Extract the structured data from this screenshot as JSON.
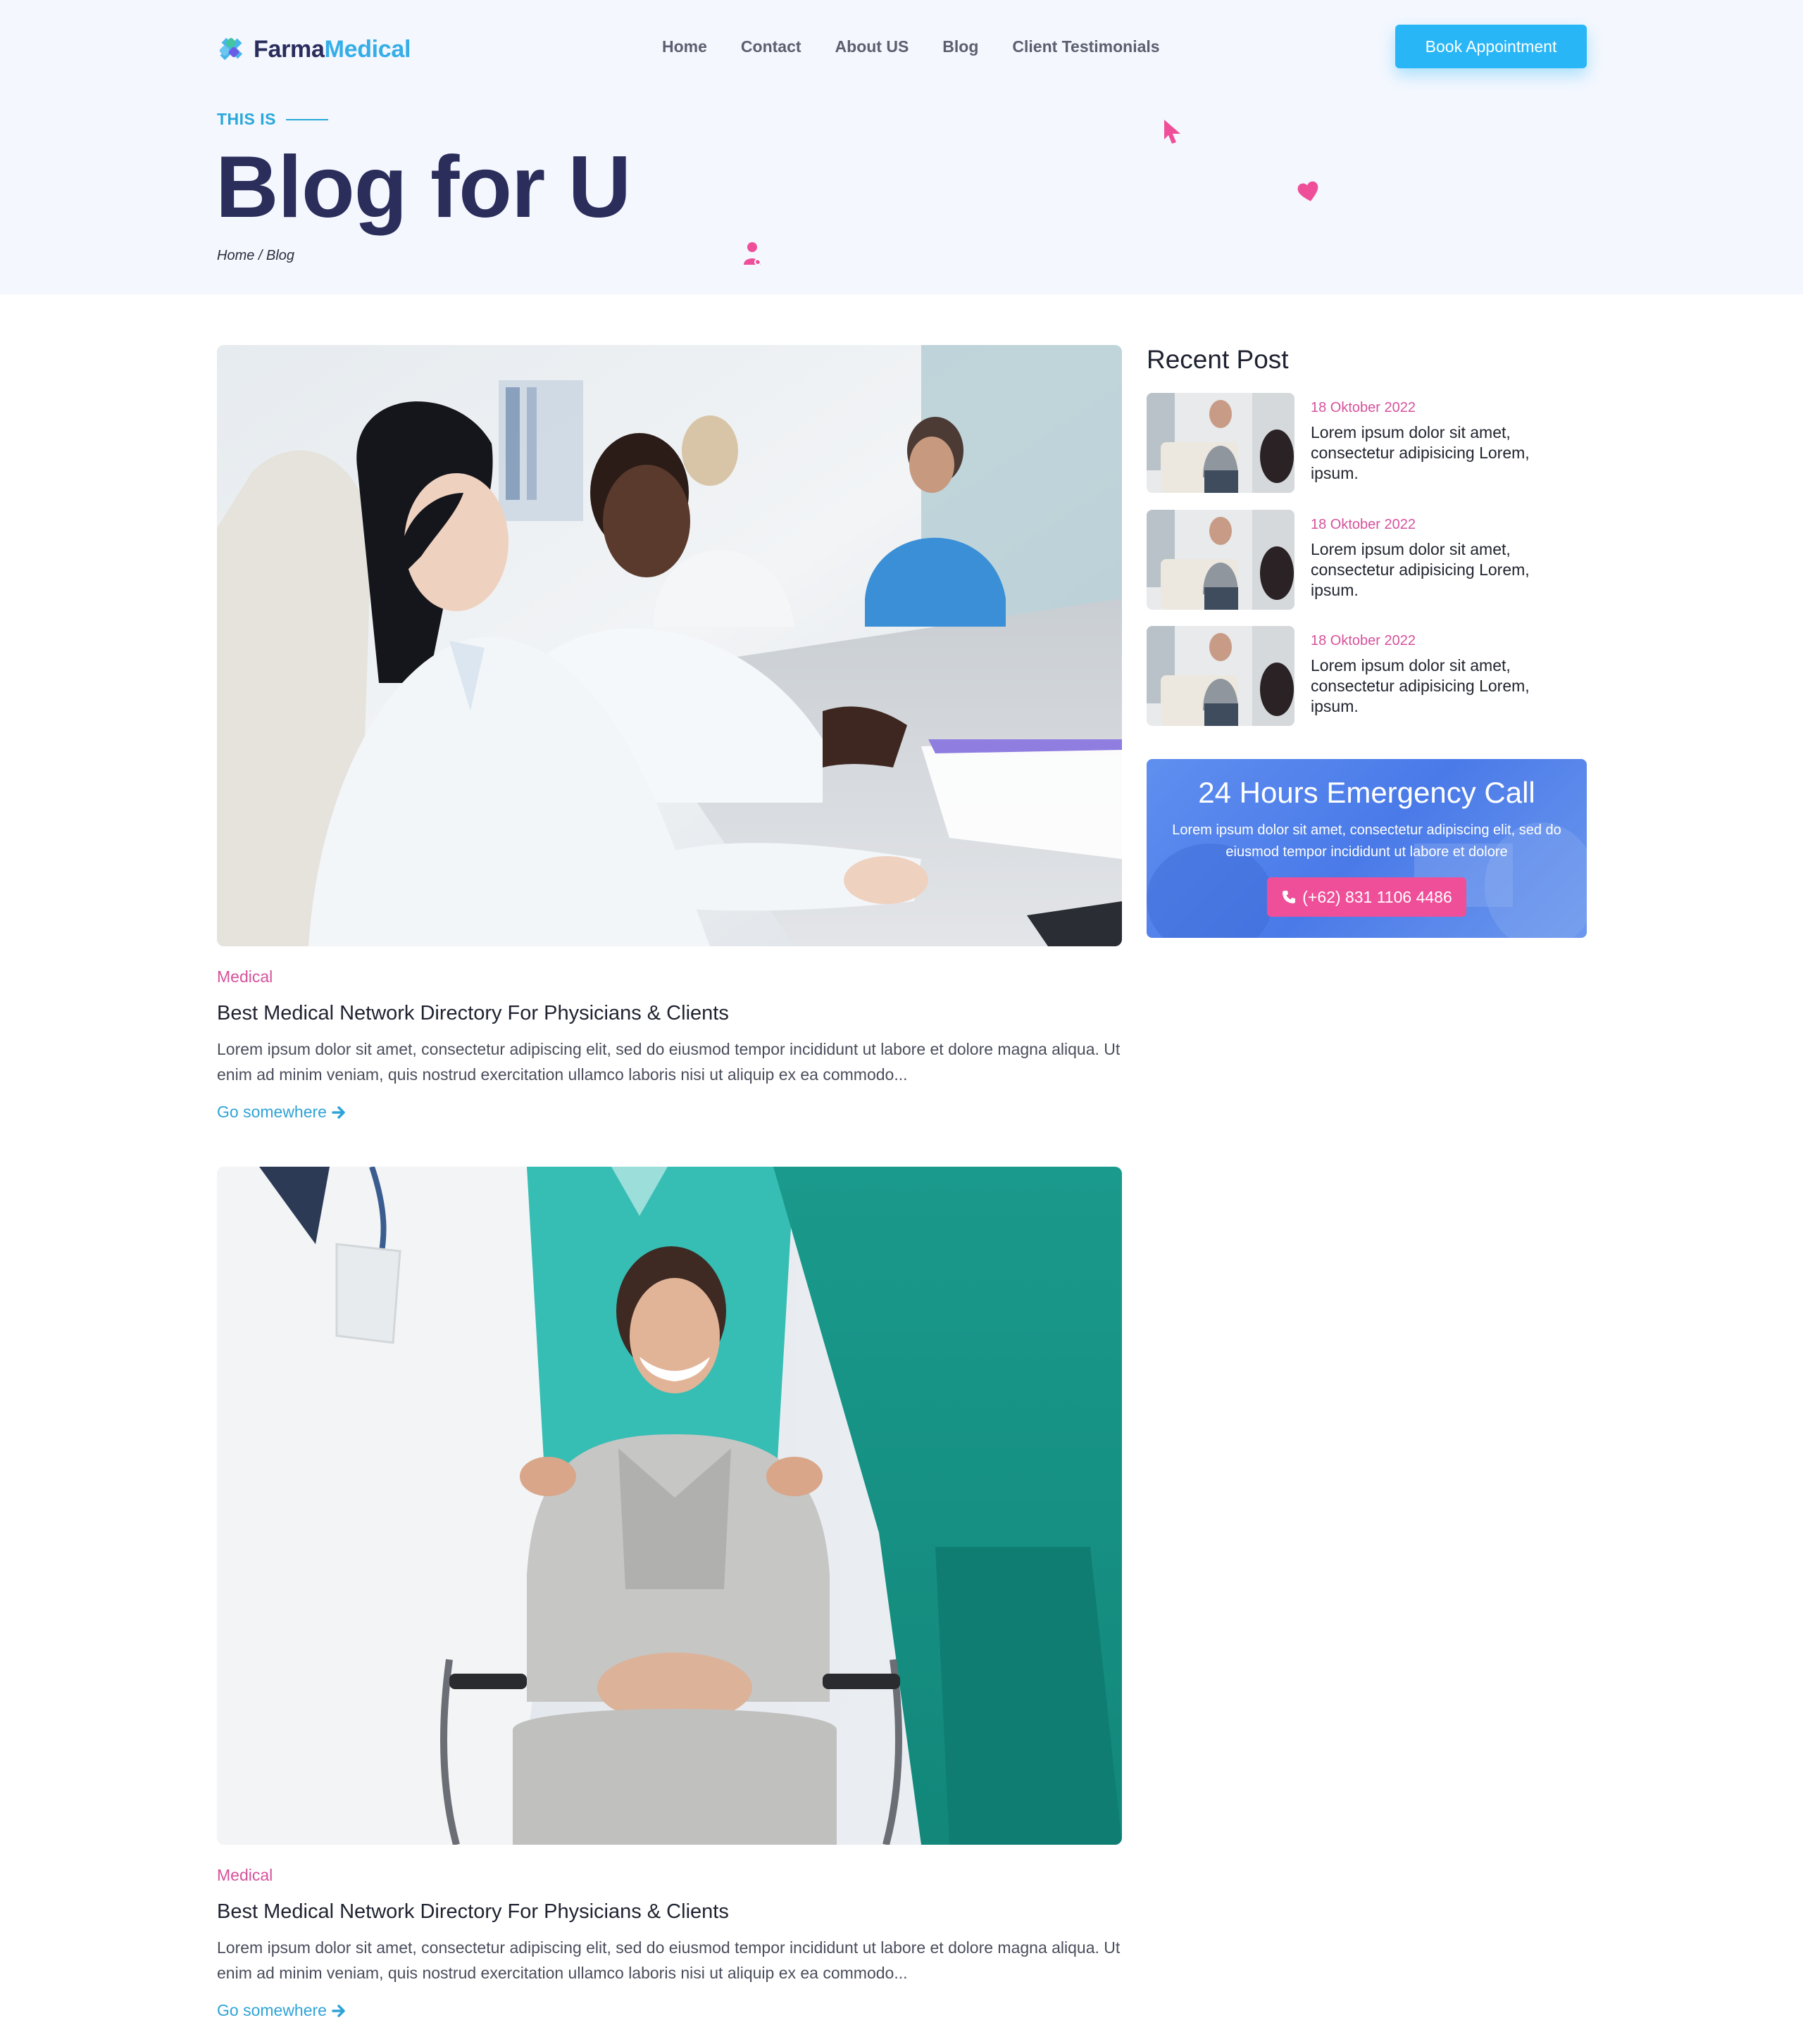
{
  "header": {
    "logo_part1": "Farma",
    "logo_part2": "Medical",
    "nav": [
      "Home",
      "Contact",
      "About US",
      "Blog",
      "Client Testimonials"
    ],
    "cta": "Book Appointment"
  },
  "hero": {
    "eyebrow": "THIS IS",
    "title": "Blog for U",
    "breadcrumb": "Home / Blog"
  },
  "posts": [
    {
      "category": "Medical",
      "title": "Best Medical Network Directory For Physicians & Clients",
      "excerpt": "Lorem ipsum dolor sit amet, consectetur adipiscing elit, sed do eiusmod tempor incididunt ut labore et dolore magna aliqua. Ut enim ad minim veniam, quis nostrud exercitation ullamco laboris nisi ut aliquip ex ea commodo...",
      "link": "Go somewhere"
    },
    {
      "category": "Medical",
      "title": "Best Medical Network Directory For Physicians & Clients",
      "excerpt": "Lorem ipsum dolor sit amet, consectetur adipiscing elit, sed do eiusmod tempor incididunt ut labore et dolore magna aliqua. Ut enim ad minim veniam, quis nostrud exercitation ullamco laboris nisi ut aliquip ex ea commodo...",
      "link": "Go somewhere"
    }
  ],
  "sidebar": {
    "recent_title": "Recent Post",
    "recent": [
      {
        "date": "18 Oktober 2022",
        "text": "Lorem ipsum dolor sit amet, consectetur adipisicing Lorem, ipsum."
      },
      {
        "date": "18 Oktober 2022",
        "text": "Lorem ipsum dolor sit amet, consectetur adipisicing Lorem, ipsum."
      },
      {
        "date": "18 Oktober 2022",
        "text": "Lorem ipsum dolor sit amet, consectetur adipisicing Lorem, ipsum."
      }
    ],
    "emergency": {
      "title": "24 Hours Emergency Call",
      "text": "Lorem ipsum dolor sit amet, consectetur adipiscing elit, sed do eiusmod tempor incididunt ut labore et dolore",
      "phone": "(+62) 831 1106 4486"
    }
  },
  "colors": {
    "brand_navy": "#2b2d5b",
    "brand_blue": "#29b6f6",
    "accent_pink": "#d6529b",
    "call_button": "#ef4f99",
    "hero_bg": "#f4f7fe"
  }
}
